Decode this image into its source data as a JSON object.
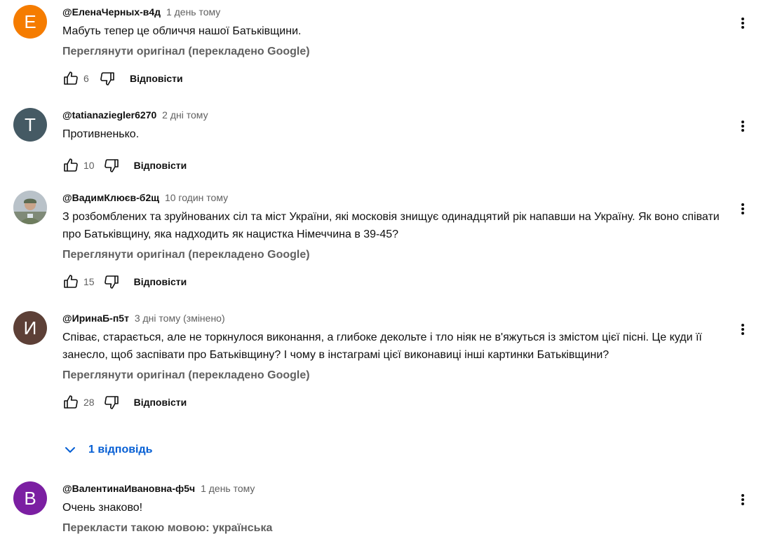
{
  "comments": [
    {
      "author": "@ЕленаЧерных-в4д",
      "time": "1 день тому",
      "avatar_letter": "Е",
      "avatar_color": "#f57c00",
      "text": "Мабуть тепер це обличчя нашої Батьківщини.",
      "translate_link": "Переглянути оригінал (перекладено Google)",
      "likes": "6",
      "reply_label": "Відповісти"
    },
    {
      "author": "@tatianaziegler6270",
      "time": "2 дні тому",
      "avatar_letter": "T",
      "avatar_color": "#455a64",
      "text": "Противненько.",
      "likes": "10",
      "reply_label": "Відповісти"
    },
    {
      "author": "@ВадимКлюєв-б2щ",
      "time": "10 годин тому",
      "avatar_icon": "profile-photo",
      "text": "З розбомблених та зруйнованих сіл та міст України, які московія знищує одинадцятий рік напавши на Україну. Як воно співати про Батьківщину, яка надходить як нацистка Німеччина в 39-45?",
      "translate_link": "Переглянути оригінал (перекладено Google)",
      "likes": "15",
      "reply_label": "Відповісти"
    },
    {
      "author": "@ИринаБ-п5т",
      "time": "3 дні тому (змінено)",
      "avatar_letter": "И",
      "avatar_color": "#5d4037",
      "text": "Співає, старається, але не торкнулося виконання, а глибоке декольте і тло ніяк не в'яжуться із змістом цієї пісні. Це куди її занесло, щоб заспівати про Батьківщину?  І чому в інстаграмі цієї виконавиці інші картинки Батьківщини?",
      "translate_link": "Переглянути оригінал (перекладено Google)",
      "likes": "28",
      "reply_label": "Відповісти",
      "replies_toggle": "1 відповідь"
    },
    {
      "author": "@ВалентинаИвановна-ф5ч",
      "time": "1 день тому",
      "avatar_letter": "В",
      "avatar_color": "#7b1fa2",
      "text": "Очень знаково!",
      "translate_link": "Перекласти такою мовою: українська"
    }
  ],
  "icons": {
    "like": "thumbs-up-icon",
    "dislike": "thumbs-down-icon",
    "menu": "more-vertical-icon",
    "expand": "chevron-down-icon"
  },
  "colors": {
    "link": "#065fd4",
    "secondary": "#606060"
  }
}
